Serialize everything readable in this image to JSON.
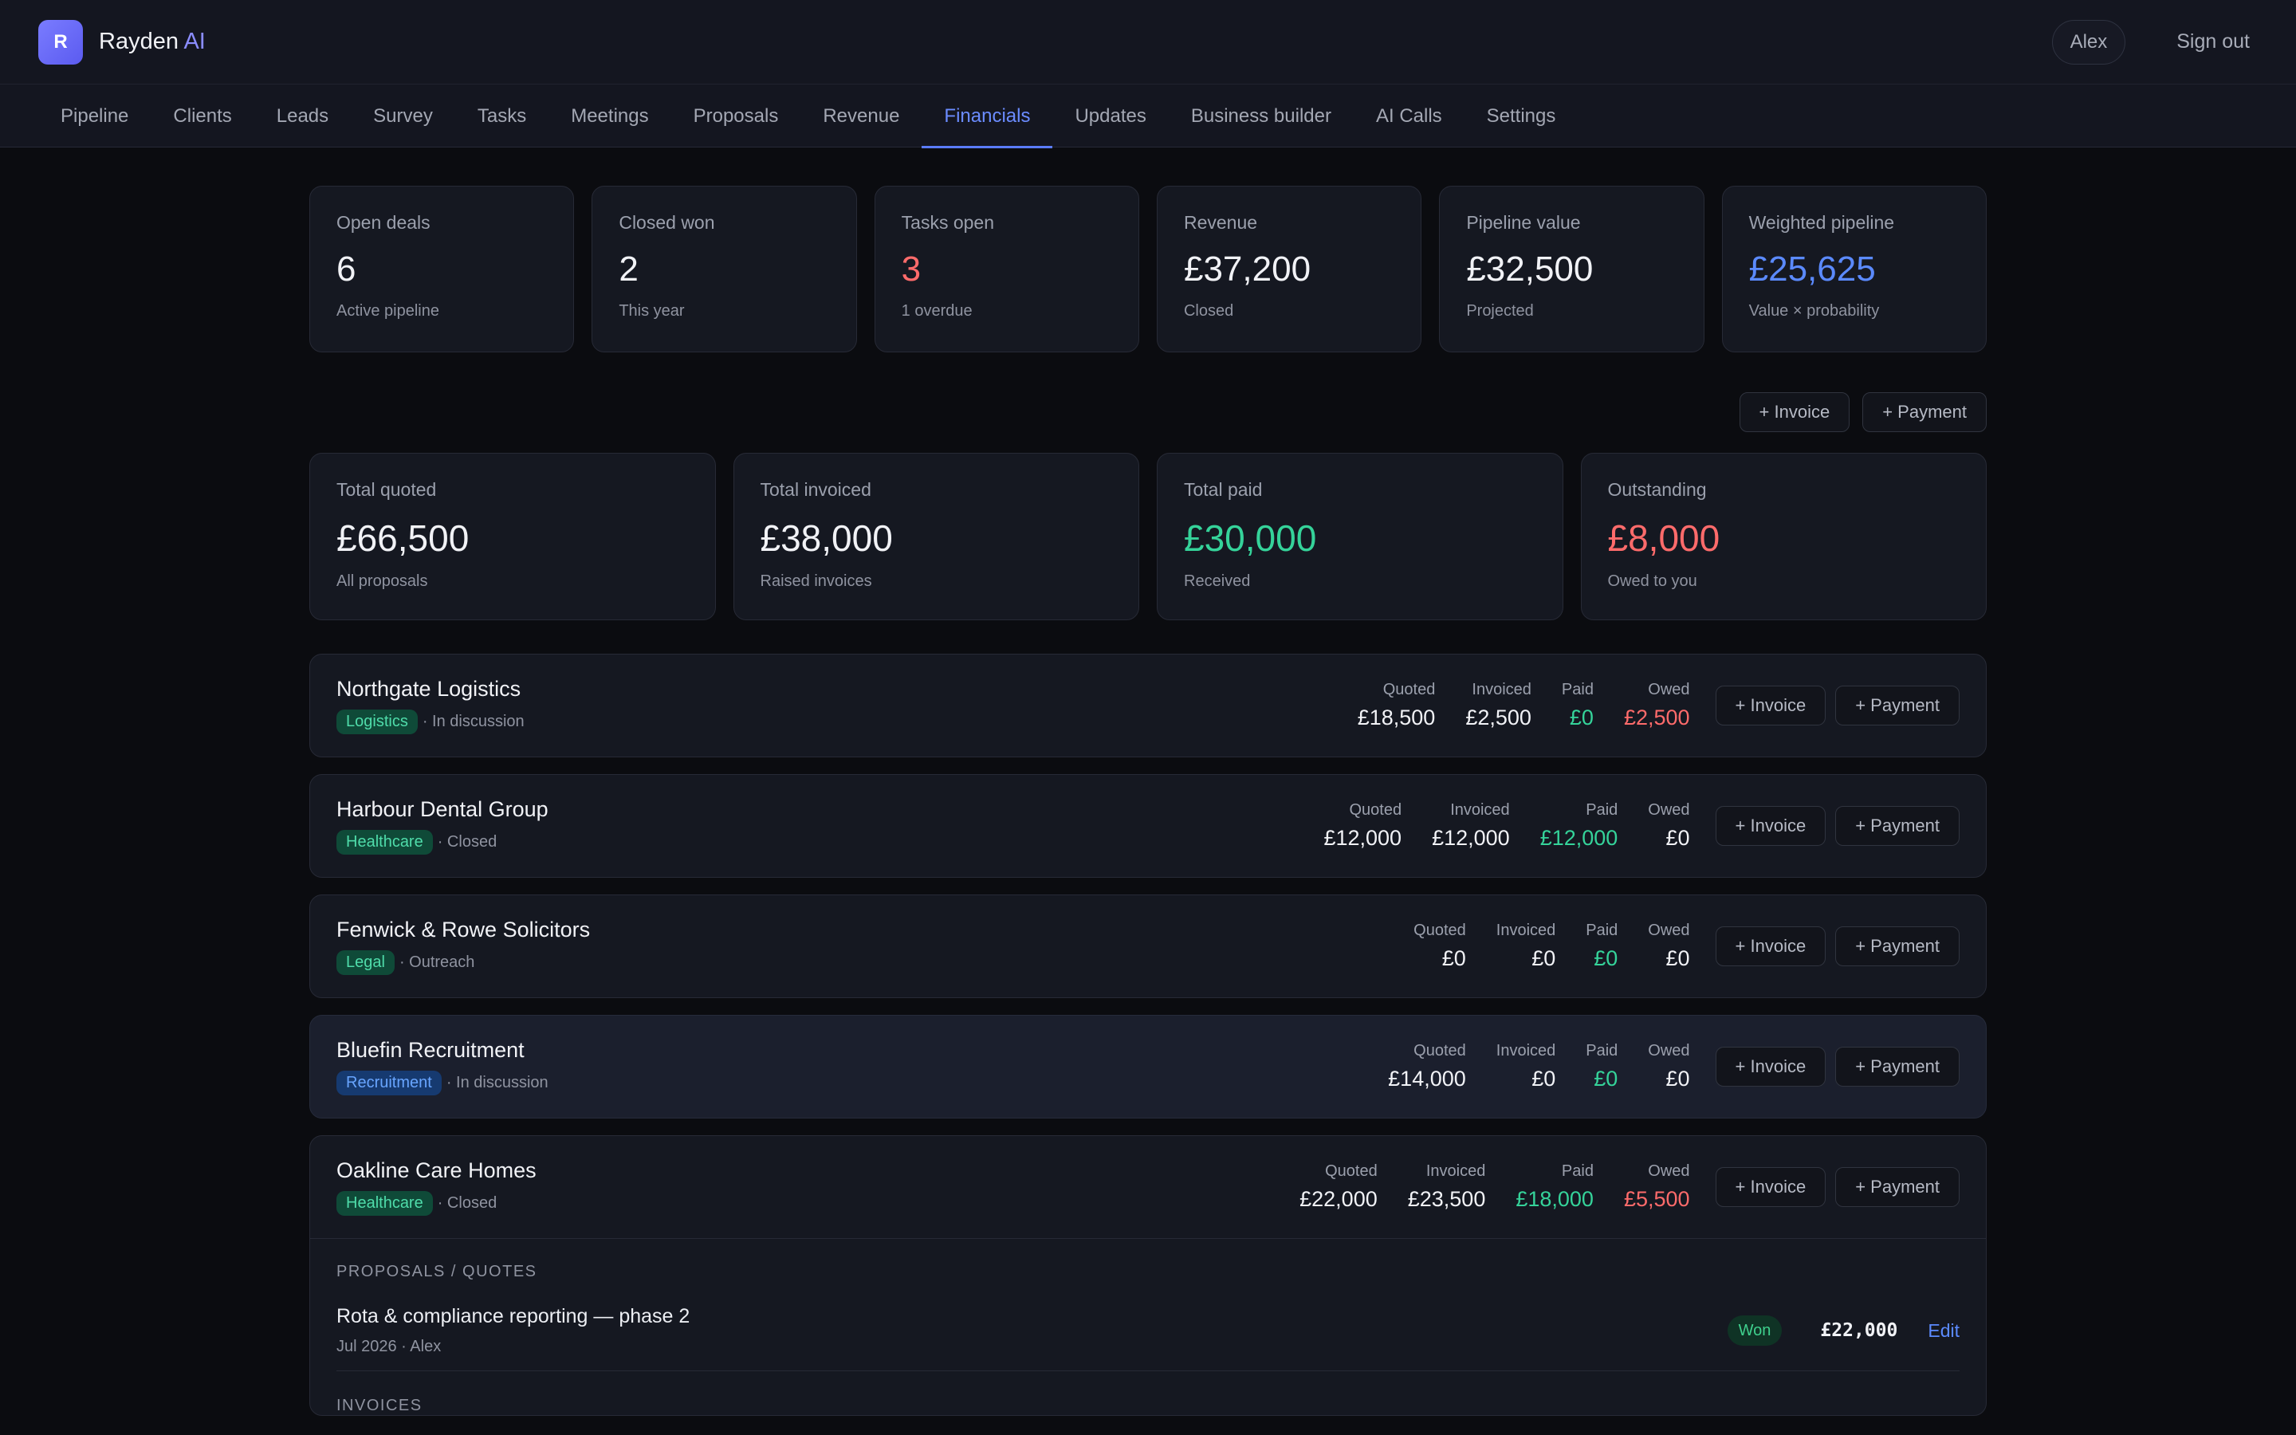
{
  "app": {
    "logo_letter": "R",
    "brand_main": "Rayden",
    "brand_accent": "AI",
    "user": "Alex",
    "sign_out": "Sign out",
    "accent_color": "#5b7cff"
  },
  "nav": {
    "items": [
      {
        "label": "Pipeline"
      },
      {
        "label": "Clients"
      },
      {
        "label": "Leads"
      },
      {
        "label": "Survey"
      },
      {
        "label": "Tasks"
      },
      {
        "label": "Meetings"
      },
      {
        "label": "Proposals"
      },
      {
        "label": "Revenue"
      },
      {
        "label": "Financials",
        "active": true
      },
      {
        "label": "Updates"
      },
      {
        "label": "Business builder"
      },
      {
        "label": "AI Calls"
      },
      {
        "label": "Settings"
      }
    ]
  },
  "kpis": [
    {
      "label": "Open deals",
      "value": "6",
      "sub": "Active pipeline"
    },
    {
      "label": "Closed won",
      "value": "2",
      "sub": "This year"
    },
    {
      "label": "Tasks open",
      "value": "3",
      "sub": "1 overdue"
    },
    {
      "label": "Revenue",
      "value": "£37,200",
      "sub": "Closed"
    },
    {
      "label": "Pipeline value",
      "value": "£32,500",
      "sub": "Projected"
    },
    {
      "label": "Weighted pipeline",
      "value": "£25,625",
      "sub": "Value × probability"
    }
  ],
  "actions": {
    "invoice": "+ Invoice",
    "payment": "+ Payment"
  },
  "totals": [
    {
      "label": "Total quoted",
      "value": "£66,500",
      "sub": "All proposals"
    },
    {
      "label": "Total invoiced",
      "value": "£38,000",
      "sub": "Raised invoices"
    },
    {
      "label": "Total paid",
      "value": "£30,000",
      "sub": "Received"
    },
    {
      "label": "Outstanding",
      "value": "£8,000",
      "sub": "Owed to you"
    }
  ],
  "stat_labels": {
    "quoted": "Quoted",
    "invoiced": "Invoiced",
    "paid": "Paid",
    "owed": "Owed"
  },
  "clients": [
    {
      "name": "Northgate Logistics",
      "tag": "Logistics",
      "status": "· In discussion",
      "quoted": "£18,500",
      "invoiced": "£2,500",
      "paid": "£0",
      "owed": "£2,500"
    },
    {
      "name": "Harbour Dental Group",
      "tag": "Healthcare",
      "status": "· Closed",
      "quoted": "£12,000",
      "invoiced": "£12,000",
      "paid": "£12,000",
      "owed": "£0"
    },
    {
      "name": "Fenwick & Rowe Solicitors",
      "tag": "Legal",
      "status": "· Outreach",
      "quoted": "£0",
      "invoiced": "£0",
      "paid": "£0",
      "owed": "£0"
    },
    {
      "name": "Bluefin Recruitment",
      "tag": "Recruitment",
      "status": "· In discussion",
      "quoted": "£14,000",
      "invoiced": "£0",
      "paid": "£0",
      "owed": "£0"
    },
    {
      "name": "Oakline Care Homes",
      "tag": "Healthcare",
      "status": "· Closed",
      "quoted": "£22,000",
      "invoiced": "£23,500",
      "paid": "£18,000",
      "owed": "£5,500"
    }
  ],
  "detail": {
    "proposals_title": "PROPOSALS / QUOTES",
    "proposal": {
      "title": "Rota & compliance reporting — phase 2",
      "meta": "Jul 2026 · Alex",
      "status": "Won",
      "amount": "£22,000",
      "edit": "Edit"
    },
    "invoices_title": "INVOICES"
  }
}
